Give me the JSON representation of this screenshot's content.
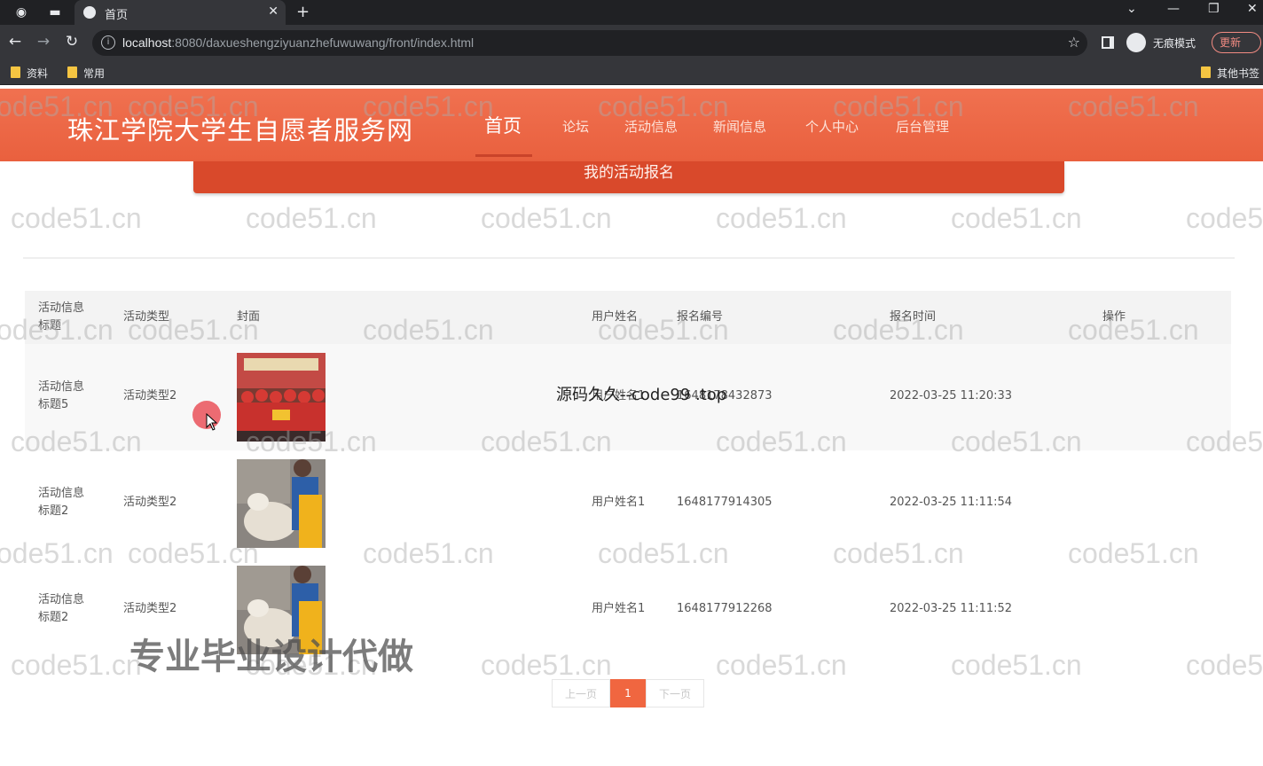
{
  "browser": {
    "tab_title": "首页",
    "url_host": "localhost",
    "url_rest": ":8080/daxueshengziyuanzhefuwuwang/front/index.html",
    "incognito_label": "无痕模式",
    "update_label": "更新",
    "bookmarks": [
      "资料",
      "常用"
    ],
    "other_bookmarks": "其他书签"
  },
  "header": {
    "site_title": "珠江学院大学生自愿者服务网",
    "nav": [
      {
        "label": "首页",
        "active": true
      },
      {
        "label": "论坛"
      },
      {
        "label": "活动信息"
      },
      {
        "label": "新闻信息"
      },
      {
        "label": "个人中心"
      },
      {
        "label": "后台管理"
      }
    ]
  },
  "section_title": "我的活动报名",
  "table": {
    "columns": [
      "活动信息\n标题",
      "活动类型",
      "封面",
      "用户姓名",
      "报名编号",
      "报名时间",
      "操作"
    ],
    "rows": [
      {
        "title": "活动信息\n标题5",
        "type": "活动类型2",
        "user": "用户姓名1",
        "number": "1648178432873",
        "time": "2022-03-25 11:20:33"
      },
      {
        "title": "活动信息\n标题2",
        "type": "活动类型2",
        "user": "用户姓名1",
        "number": "1648177914305",
        "time": "2022-03-25 11:11:54"
      },
      {
        "title": "活动信息\n标题2",
        "type": "活动类型2",
        "user": "用户姓名1",
        "number": "1648177912268",
        "time": "2022-03-25 11:11:52"
      }
    ]
  },
  "pagination": {
    "prev": "上一页",
    "current": "1",
    "next": "下一页"
  },
  "watermarks": {
    "text": "code51.cn",
    "overlay_mid": "源码久久--code99 .top",
    "overlay_big": "专业毕业设计代做"
  }
}
